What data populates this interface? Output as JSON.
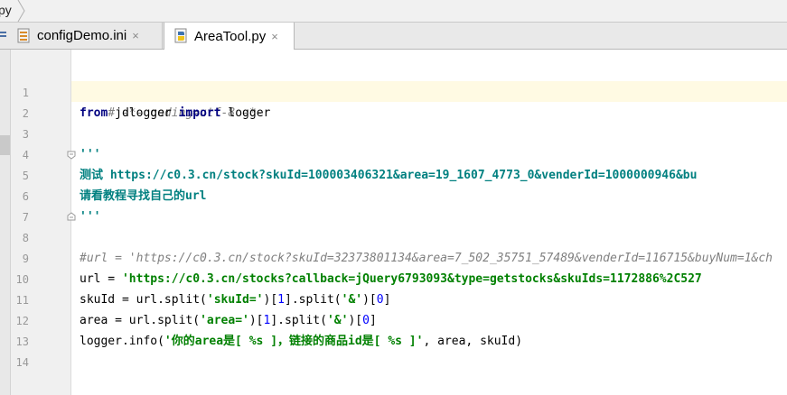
{
  "breadcrumb": {
    "file": "py"
  },
  "tabs": [
    {
      "label": "configDemo.ini",
      "close": "×",
      "active": false
    },
    {
      "label": "AreaTool.py",
      "close": "×",
      "active": true
    }
  ],
  "editor": {
    "line_numbers": [
      "1",
      "2",
      "3",
      "4",
      "5",
      "6",
      "7",
      "8",
      "9",
      "10",
      "11",
      "12",
      "13",
      "14"
    ],
    "lines": {
      "l1": "# -*- coding=utf-8 -*-",
      "l2_kw1": "from",
      "l2_mod": " jdlogger ",
      "l2_kw2": "import",
      "l2_name": " logger",
      "l4": "'''",
      "l5": "测试 https://c0.3.cn/stock?skuId=100003406321&area=19_1607_4773_0&venderId=1000000946&bu",
      "l6": "请看教程寻找自己的url",
      "l7": "'''",
      "l9": "#url = 'https://c0.3.cn/stock?skuId=32373801134&area=7_502_35751_57489&venderId=116715&buyNum=1&ch",
      "l10_a": "url = ",
      "l10_str": "'https://c0.3.cn/stocks?callback=jQuery6793093&type=getstocks&skuIds=1172886%2C527",
      "l11_a": "skuId = url.split(",
      "l11_s1": "'skuId='",
      "l11_b": ")[",
      "l11_n1": "1",
      "l11_c": "].split(",
      "l11_s2": "'&'",
      "l11_d": ")[",
      "l11_n2": "0",
      "l11_e": "]",
      "l12_a": "area = url.split(",
      "l12_s1": "'area='",
      "l12_b": ")[",
      "l12_n1": "1",
      "l12_c": "].split(",
      "l12_s2": "'&'",
      "l12_d": ")[",
      "l12_n2": "0",
      "l12_e": "]",
      "l13_a": "logger.info(",
      "l13_s": "'你的area是[ %s ]，链接的商品id是[ %s ]'",
      "l13_b": ", area, skuId)"
    }
  },
  "colors": {
    "comment": "#808080",
    "keyword": "#000080",
    "string": "#008000",
    "docstring": "#008080",
    "number": "#0000ff",
    "current_line": "#fffae3"
  }
}
